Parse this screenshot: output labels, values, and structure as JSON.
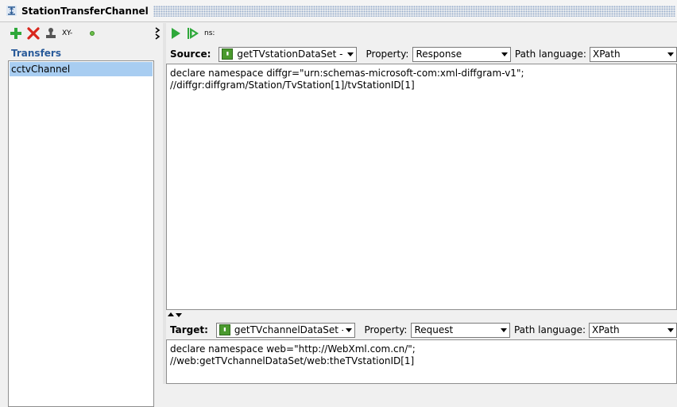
{
  "window": {
    "title": "StationTransferChannel"
  },
  "left": {
    "toolbar": {
      "xy_label": "XY-"
    },
    "section_label": "Transfers",
    "items": [
      {
        "label": "cctvChannel"
      }
    ]
  },
  "right": {
    "toolbar": {
      "ns_label": "ns:"
    },
    "source": {
      "label": "Source:",
      "operation": "getTVstationDataSet - R...",
      "property_label": "Property:",
      "property_value": "Response",
      "path_language_label": "Path language:",
      "path_language_value": "XPath",
      "lines": [
        "declare namespace diffgr=\"urn:schemas-microsoft-com:xml-diffgram-v1\";",
        "//diffgr:diffgram/Station/TvStation[1]/tvStationID[1]"
      ]
    },
    "target": {
      "label": "Target:",
      "operation": "getTVchannelDataSet - ...",
      "property_label": "Property:",
      "property_value": "Request",
      "path_language_label": "Path language:",
      "path_language_value": "XPath",
      "lines": [
        "declare namespace web=\"http://WebXml.com.cn/\";",
        "//web:getTVchannelDataSet/web:theTVstationID[1]"
      ]
    }
  },
  "colors": {
    "selection": "#a8cdf1",
    "section_label": "#2a5b9a",
    "run_green": "#2ea83a",
    "delete_red": "#d8261c"
  }
}
